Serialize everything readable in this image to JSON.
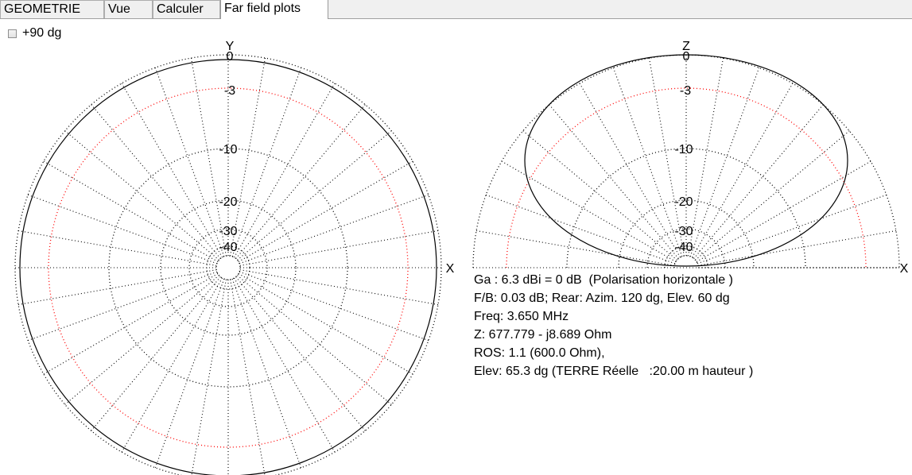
{
  "tabs": [
    {
      "label": "GEOMETRIE",
      "active": false
    },
    {
      "label": "Vue",
      "active": false
    },
    {
      "label": "Calculer",
      "active": false
    },
    {
      "label": "Far field plots",
      "active": true
    }
  ],
  "options": {
    "plus90_label": "+90 dg",
    "plus90_checked": false
  },
  "azimuth_plot": {
    "axis_top_label": "Y",
    "axis_right_label": "X",
    "ring_labels": [
      "0",
      "-3",
      "-10",
      "-20",
      "-30",
      "-40"
    ]
  },
  "elevation_plot": {
    "axis_top_label": "Z",
    "axis_right_label": "X",
    "ring_labels": [
      "0",
      "-3",
      "-10",
      "-20",
      "-30",
      "-40"
    ]
  },
  "results": {
    "gain": "Ga : 6.3 dBi = 0 dB  (Polarisation horizontale )",
    "front_back": "F/B: 0.03 dB; Rear: Azim. 120 dg, Elev. 60 dg",
    "freq": "Freq: 3.650 MHz",
    "impedance": "Z: 677.779 - j8.689 Ohm",
    "swr": "ROS: 1.1 (600.0 Ohm),",
    "elevation": "Elev: 65.3 dg (TERRE Réelle   :20.00 m hauteur )"
  },
  "colors": {
    "grid": "#000000",
    "minus3_ring": "#ff0000",
    "pattern": "#000000"
  }
}
